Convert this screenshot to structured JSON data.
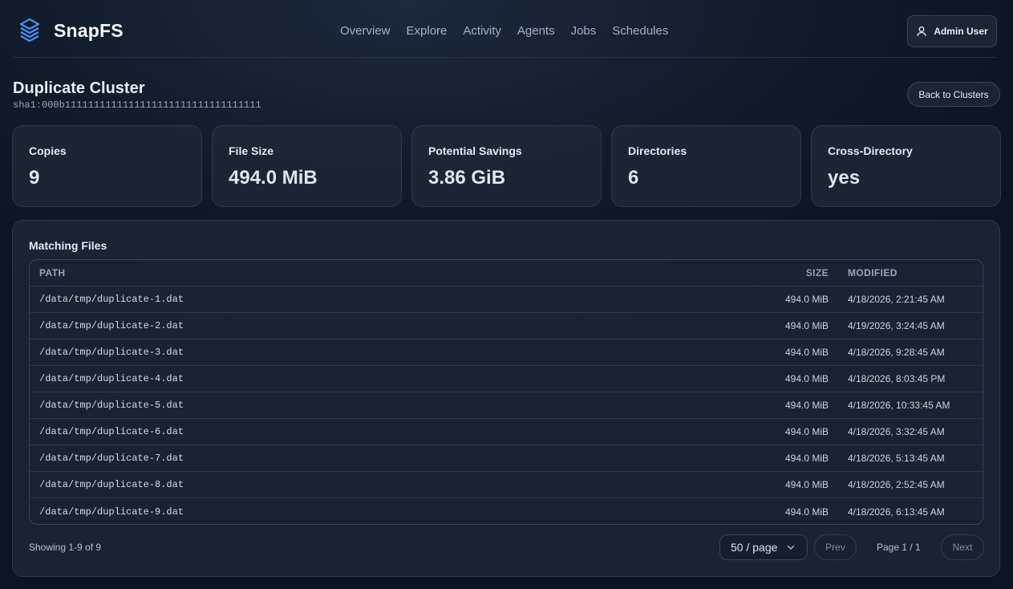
{
  "app": {
    "name": "SnapFS",
    "logo_icon": "layers-logo-icon",
    "accent": "#4f8df0"
  },
  "nav": {
    "items": [
      {
        "label": "Overview"
      },
      {
        "label": "Explore"
      },
      {
        "label": "Activity"
      },
      {
        "label": "Agents"
      },
      {
        "label": "Jobs"
      },
      {
        "label": "Schedules"
      }
    ]
  },
  "user": {
    "label": "Admin User",
    "icon": "user-icon"
  },
  "page": {
    "title": "Duplicate Cluster",
    "hash": "sha1:000b1111111111111111111111111111111111",
    "back_label": "Back to Clusters"
  },
  "stats": [
    {
      "label": "Copies",
      "value": "9"
    },
    {
      "label": "File Size",
      "value": "494.0 MiB"
    },
    {
      "label": "Potential Savings",
      "value": "3.86 GiB"
    },
    {
      "label": "Directories",
      "value": "6"
    },
    {
      "label": "Cross-Directory",
      "value": "yes"
    }
  ],
  "files": {
    "title": "Matching Files",
    "columns": {
      "path": "PATH",
      "size": "SIZE",
      "modified": "MODIFIED"
    },
    "rows": [
      {
        "path": "/data/tmp/duplicate-1.dat",
        "size": "494.0 MiB",
        "modified": "4/18/2026, 2:21:45 AM"
      },
      {
        "path": "/data/tmp/duplicate-2.dat",
        "size": "494.0 MiB",
        "modified": "4/19/2026, 3:24:45 AM"
      },
      {
        "path": "/data/tmp/duplicate-3.dat",
        "size": "494.0 MiB",
        "modified": "4/18/2026, 9:28:45 AM"
      },
      {
        "path": "/data/tmp/duplicate-4.dat",
        "size": "494.0 MiB",
        "modified": "4/18/2026, 8:03:45 PM"
      },
      {
        "path": "/data/tmp/duplicate-5.dat",
        "size": "494.0 MiB",
        "modified": "4/18/2026, 10:33:45 AM"
      },
      {
        "path": "/data/tmp/duplicate-6.dat",
        "size": "494.0 MiB",
        "modified": "4/18/2026, 3:32:45 AM"
      },
      {
        "path": "/data/tmp/duplicate-7.dat",
        "size": "494.0 MiB",
        "modified": "4/18/2026, 5:13:45 AM"
      },
      {
        "path": "/data/tmp/duplicate-8.dat",
        "size": "494.0 MiB",
        "modified": "4/18/2026, 2:52:45 AM"
      },
      {
        "path": "/data/tmp/duplicate-9.dat",
        "size": "494.0 MiB",
        "modified": "4/18/2026, 6:13:45 AM"
      }
    ],
    "showing": "Showing 1-9 of 9"
  },
  "pagination": {
    "per_page": "50 / page",
    "prev": "Prev",
    "page_info": "Page 1 / 1",
    "next": "Next"
  }
}
